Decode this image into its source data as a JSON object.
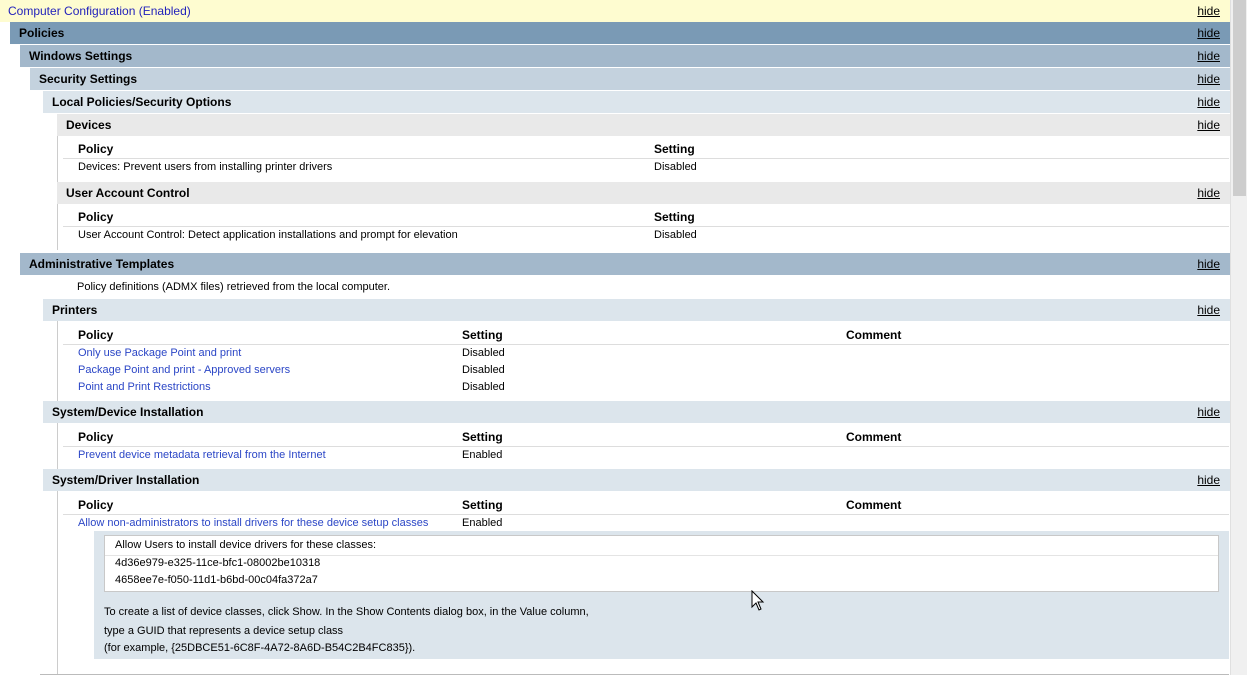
{
  "hide_label": "hide",
  "header": {
    "computer_configuration": "Computer Configuration (Enabled)"
  },
  "sections": {
    "policies": "Policies",
    "windows_settings": "Windows Settings",
    "security_settings": "Security Settings",
    "local_policies": "Local Policies/Security Options",
    "devices": "Devices",
    "uac": "User Account Control",
    "admin_templates": "Administrative Templates",
    "printers": "Printers",
    "device_install": "System/Device Installation",
    "driver_install": "System/Driver Installation"
  },
  "columns": {
    "policy": "Policy",
    "setting": "Setting",
    "comment": "Comment"
  },
  "devices_table": [
    {
      "policy": "Devices: Prevent users from installing printer drivers",
      "setting": "Disabled"
    }
  ],
  "uac_table": [
    {
      "policy": "User Account Control: Detect application installations and prompt for elevation",
      "setting": "Disabled"
    }
  ],
  "admin_templates_note": "Policy definitions (ADMX files) retrieved from the local computer.",
  "printers_table": [
    {
      "policy": "Only use Package Point and print",
      "setting": "Disabled"
    },
    {
      "policy": "Package Point and print - Approved servers",
      "setting": "Disabled"
    },
    {
      "policy": "Point and Print Restrictions",
      "setting": "Disabled"
    }
  ],
  "device_install_table": [
    {
      "policy": "Prevent device metadata retrieval from the Internet",
      "setting": "Enabled"
    }
  ],
  "driver_install_table": [
    {
      "policy": "Allow non-administrators to install drivers for these device setup classes",
      "setting": "Enabled"
    }
  ],
  "driver_detail": {
    "label": "Allow Users to install device drivers for these classes:",
    "guids": [
      "4d36e979-e325-11ce-bfc1-08002be10318",
      "4658ee7e-f050-11d1-b6bd-00c04fa372a7"
    ],
    "help": [
      "To create a list of device classes, click Show. In the Show Contents dialog box, in the Value column,",
      "type a GUID that represents a device setup class",
      "(for example, {25DBCE51-6C8F-4A72-8A6D-B54C2B4FC835})."
    ]
  }
}
